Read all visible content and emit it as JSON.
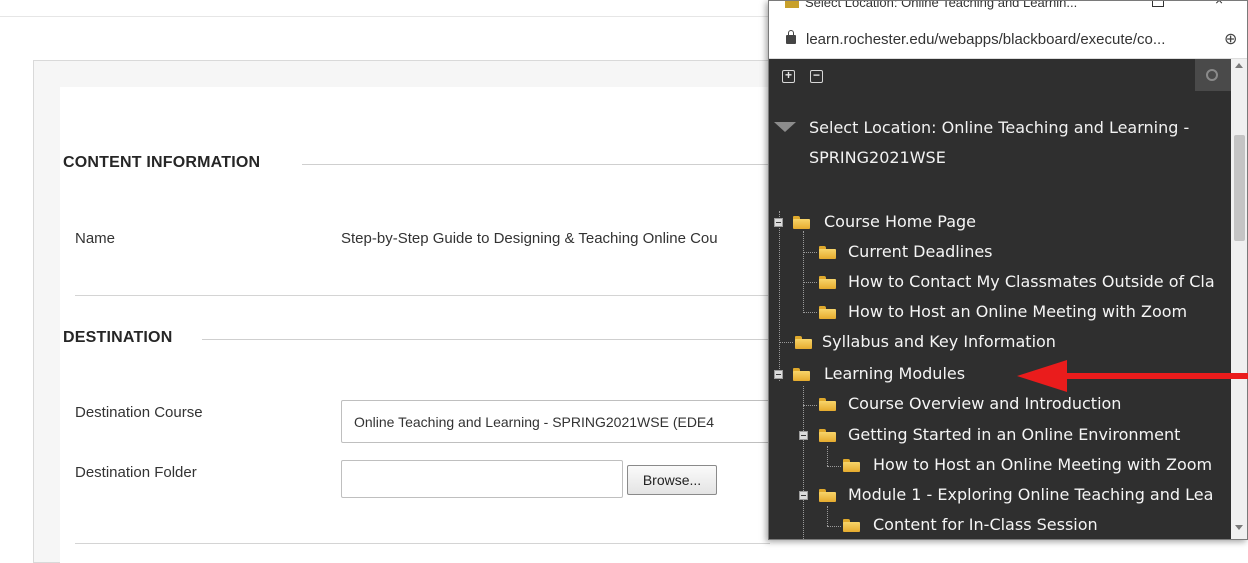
{
  "content_information": {
    "title": "CONTENT INFORMATION",
    "name_label": "Name",
    "name_value": "Step-by-Step Guide to Designing & Teaching Online Cou"
  },
  "destination": {
    "title": "DESTINATION",
    "course_label": "Destination Course",
    "course_value": "Online Teaching and Learning - SPRING2021WSE (EDE4",
    "folder_label": "Destination Folder",
    "folder_value": "",
    "browse_label": "Browse..."
  },
  "popup": {
    "window_title": "Select Location: Online Teaching and Learnin...",
    "url": "learn.rochester.edu/webapps/blackboard/execute/co...",
    "expand_all_glyph": "+",
    "collapse_all_glyph": "−",
    "select_location_line1": "Select Location: Online Teaching and Learning -",
    "select_location_line2": "SPRING2021WSE",
    "tree": [
      {
        "label": "Course Home Page",
        "level": 0,
        "expanded": true
      },
      {
        "label": "Current Deadlines",
        "level": 1,
        "expanded": false
      },
      {
        "label": "How to Contact My Classmates Outside of Cla",
        "level": 1,
        "expanded": false
      },
      {
        "label": "How to Host an Online Meeting with Zoom",
        "level": 1,
        "expanded": false
      },
      {
        "label": "Syllabus and Key Information",
        "level": 0,
        "expanded": false
      },
      {
        "label": "Learning Modules",
        "level": 0,
        "expanded": true
      },
      {
        "label": "Course Overview and Introduction",
        "level": 1,
        "expanded": false
      },
      {
        "label": "Getting Started in an Online Environment",
        "level": 1,
        "expanded": true
      },
      {
        "label": "How to Host an Online Meeting with Zoom",
        "level": 2,
        "expanded": false
      },
      {
        "label": "Module 1 - Exploring Online Teaching and Lea",
        "level": 1,
        "expanded": true
      },
      {
        "label": "Content for In-Class Session",
        "level": 2,
        "expanded": false
      }
    ]
  },
  "annotation": {
    "arrow_color": "#ea1c1c",
    "arrow_points_to": "Learning Modules"
  },
  "colors": {
    "popup_background": "#2f2f2f",
    "folder_yellow": "#f8d56a",
    "tree_text": "#f5f5f5"
  }
}
